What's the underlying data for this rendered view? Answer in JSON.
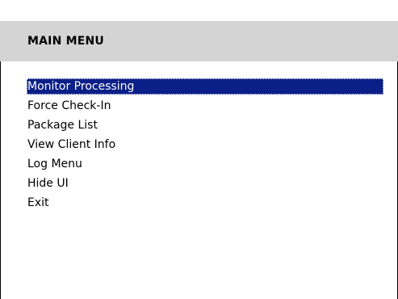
{
  "header": {
    "title": "MAIN MENU"
  },
  "menu": {
    "selected_index": 0,
    "items": [
      {
        "label": "Monitor Processing"
      },
      {
        "label": "Force Check-In"
      },
      {
        "label": "Package List"
      },
      {
        "label": "View Client Info"
      },
      {
        "label": "Log Menu"
      },
      {
        "label": "Hide UI"
      },
      {
        "label": "Exit"
      }
    ]
  },
  "colors": {
    "header_bg": "#d4d4d4",
    "selection_bg": "#0a1f87",
    "selection_fg": "#ffffff",
    "text": "#000000"
  }
}
